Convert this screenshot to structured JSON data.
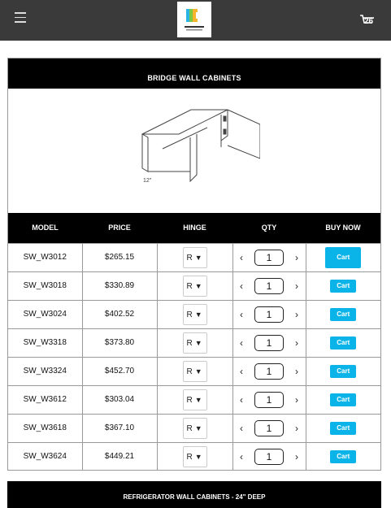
{
  "header": {
    "menu_icon": "hamburger-icon",
    "logo_icon": "cabinet-logo-icon",
    "cart_icon": "cart-icon",
    "cart_count": "26",
    "background": "#3a3a3a"
  },
  "sections": [
    {
      "title": "BRIDGE WALL CABINETS",
      "illustration_label": "12\"",
      "columns": [
        "MODEL",
        "PRICE",
        "HINGE",
        "QTY",
        "BUY NOW"
      ],
      "rows": [
        {
          "model": "SW_W3012",
          "price": "$265.15",
          "hinge": "R",
          "qty": "1",
          "button": "Cart"
        },
        {
          "model": "SW_W3018",
          "price": "$330.89",
          "hinge": "R",
          "qty": "1",
          "button": "Cart"
        },
        {
          "model": "SW_W3024",
          "price": "$402.52",
          "hinge": "R",
          "qty": "1",
          "button": "Cart"
        },
        {
          "model": "SW_W3318",
          "price": "$373.80",
          "hinge": "R",
          "qty": "1",
          "button": "Cart"
        },
        {
          "model": "SW_W3324",
          "price": "$452.70",
          "hinge": "R",
          "qty": "1",
          "button": "Cart"
        },
        {
          "model": "SW_W3612",
          "price": "$303.04",
          "hinge": "R",
          "qty": "1",
          "button": "Cart"
        },
        {
          "model": "SW_W3618",
          "price": "$367.10",
          "hinge": "R",
          "qty": "1",
          "button": "Cart"
        },
        {
          "model": "SW_W3624",
          "price": "$449.21",
          "hinge": "R",
          "qty": "1",
          "button": "Cart"
        }
      ]
    },
    {
      "title": "REFRIGERATOR WALL CABINETS - 24\" DEEP"
    }
  ],
  "qty_decrement_glyph": "‹",
  "qty_increment_glyph": "›",
  "dropdown_glyph": "▼",
  "colors": {
    "accent": "#0bb4e8",
    "header_bg": "#000000"
  }
}
